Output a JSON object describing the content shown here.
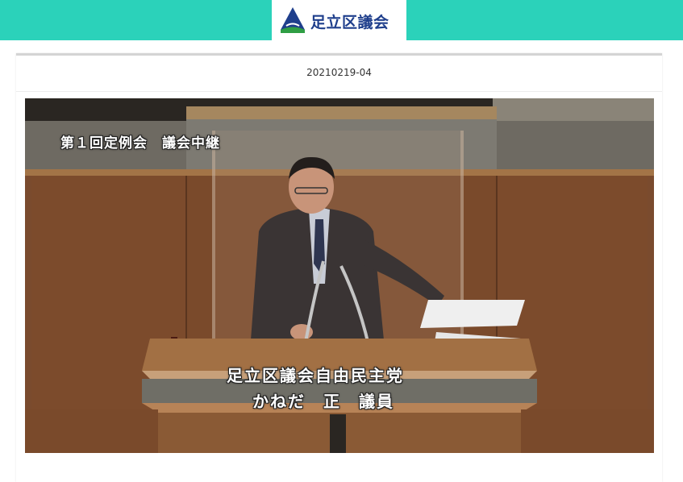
{
  "header": {
    "brand_color": "#2bd2ba",
    "logo_icon": "triangle-logo-icon",
    "logo_text": "足立区議会"
  },
  "video": {
    "id": "20210219-04",
    "broadcast_caption": "第１回定例会　議会中継",
    "speaker_party": "足立区議会自由民主党",
    "speaker_name": "かねだ　正　議員"
  }
}
